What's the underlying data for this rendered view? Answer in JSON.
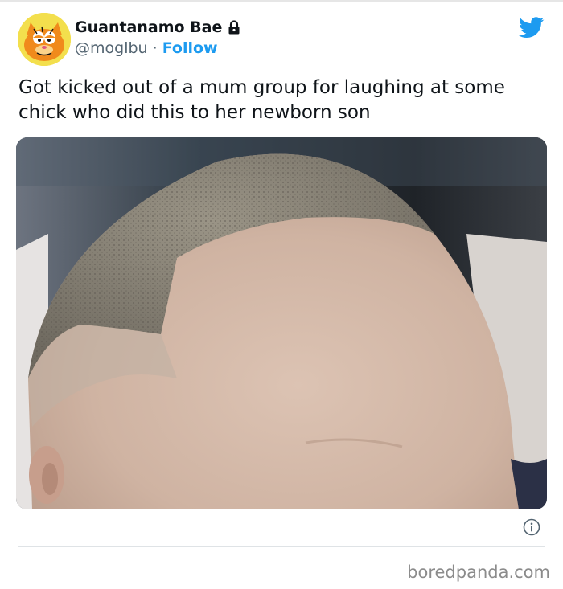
{
  "tweet": {
    "display_name": "Guantanamo Bae",
    "handle": "@moglbu",
    "separator": "·",
    "follow_label": "Follow",
    "text": "Got kicked out of a mum group for laughing at some chick who did this to her newborn son",
    "brand_color": "#1d9bf0",
    "icons": [
      "lock-icon",
      "twitter-bird-icon",
      "info-icon"
    ]
  },
  "footer": {
    "watermark": "boredpanda.com"
  }
}
